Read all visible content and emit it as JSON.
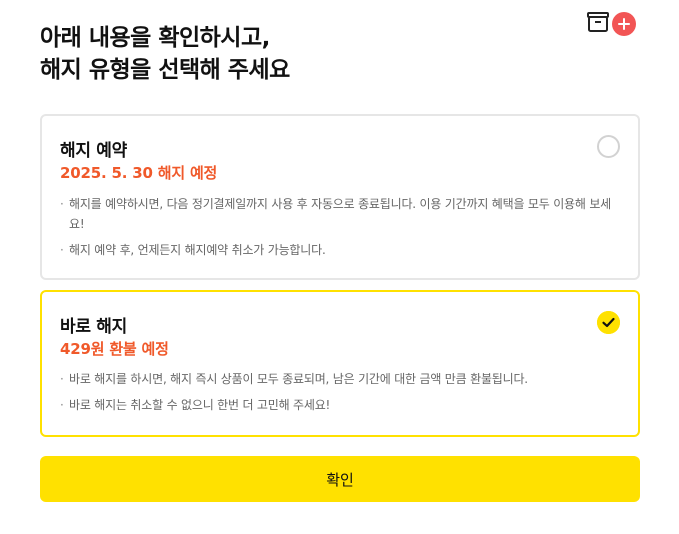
{
  "header": {
    "icon": "add-bookmark-icon",
    "accent_color": "#f25555",
    "title_line1": "아래 내용을 확인하시고,",
    "title_line2": "해지 유형을 선택해 주세요"
  },
  "options": [
    {
      "title": "해지 예약",
      "subtitle": "2025. 5. 30 해지 예정",
      "selected": false,
      "notes": [
        "해지를 예약하시면, 다음 정기결제일까지 사용 후 자동으로 종료됩니다. 이용 기간까지 혜택을 모두 이용해 보세요!",
        "해지 예약 후, 언제든지 해지예약 취소가 가능합니다."
      ]
    },
    {
      "title": "바로 해지",
      "subtitle": "429원 환불 예정",
      "selected": true,
      "notes": [
        "바로 해지를 하시면, 해지 즉시 상품이 모두 종료되며, 남은 기간에 대한 금액 만큼 환불됩니다.",
        "바로 해지는 취소할 수 없으니 한번 더 고민해 주세요!"
      ]
    }
  ],
  "confirm_label": "확인",
  "colors": {
    "highlight": "#ffe100",
    "subtitle": "#f0592a",
    "border": "#e6e6e6"
  }
}
